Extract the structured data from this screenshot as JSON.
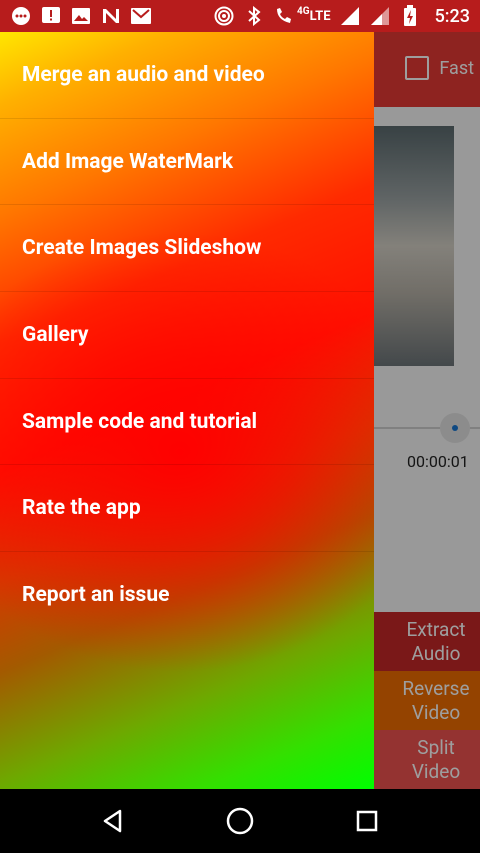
{
  "status_bar": {
    "time": "5:23",
    "network_label": "LTE",
    "network_type": "4G",
    "icons_left": [
      "chat-icon",
      "alert-icon",
      "image-icon",
      "n-icon",
      "mail-icon"
    ],
    "icons_right": [
      "hotspot-icon",
      "bluetooth-icon",
      "wifi-call-icon",
      "signal-icon",
      "signal-icon",
      "battery-icon"
    ]
  },
  "background_app": {
    "fast_label": "Fast",
    "timecode": "00:00:01",
    "tools": [
      {
        "label": "Extract Audio"
      },
      {
        "label": "Reverse Video"
      },
      {
        "label": "Split Video"
      }
    ]
  },
  "drawer": {
    "items": [
      {
        "label": "Merge an audio and video"
      },
      {
        "label": "Add Image WaterMark"
      },
      {
        "label": "Create Images Slideshow"
      },
      {
        "label": "Gallery"
      },
      {
        "label": "Sample code and tutorial"
      },
      {
        "label": "Rate the app"
      },
      {
        "label": "Report an issue"
      }
    ]
  },
  "colors": {
    "status_bar": "#b71c1c",
    "app_bar": "#e53935",
    "drawer_gradient": [
      "#ffe600",
      "#ff1000",
      "#00ff00"
    ]
  }
}
